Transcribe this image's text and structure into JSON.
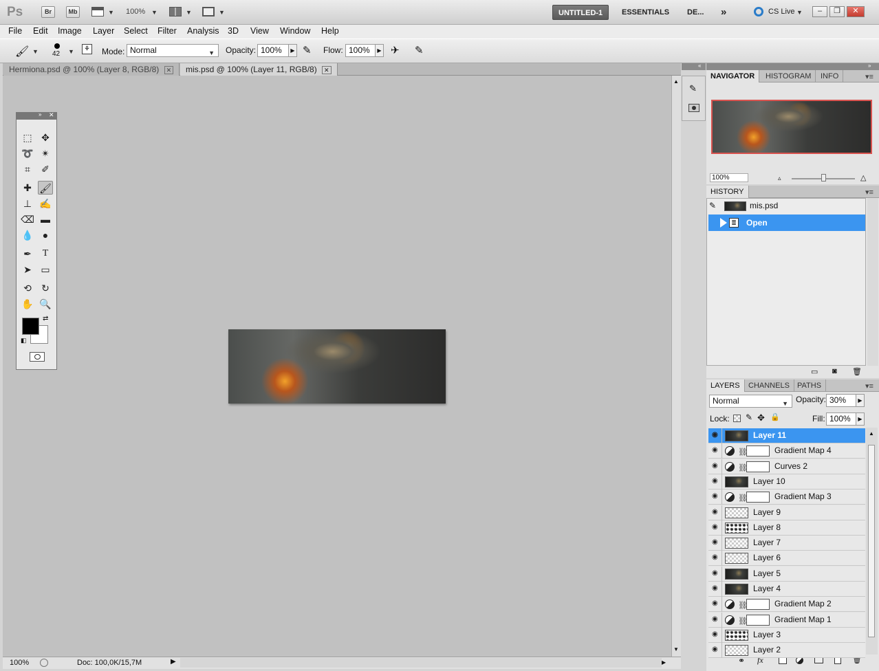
{
  "app": {
    "logo": "Ps",
    "bridge": "Br",
    "minibridge": "Mb",
    "zoom": "100%",
    "workspaces": [
      "UNTITLED-1",
      "ESSENTIALS",
      "DE..."
    ],
    "more": "»",
    "cslive": "CS Live"
  },
  "menu": [
    "File",
    "Edit",
    "Image",
    "Layer",
    "Select",
    "Filter",
    "Analysis",
    "3D",
    "View",
    "Window",
    "Help"
  ],
  "options": {
    "brush_size": "42",
    "mode_label": "Mode:",
    "mode_value": "Normal",
    "opacity_label": "Opacity:",
    "opacity_value": "100%",
    "flow_label": "Flow:",
    "flow_value": "100%"
  },
  "tabs": [
    {
      "label": "Hermiona.psd @ 100% (Layer 8, RGB/8)",
      "active": false
    },
    {
      "label": "mis.psd @ 100% (Layer 11, RGB/8)",
      "active": true
    }
  ],
  "status": {
    "zoom": "100%",
    "doc": "Doc: 100,0K/15,7M"
  },
  "navigator": {
    "tabs": [
      "NAVIGATOR",
      "HISTOGRAM",
      "INFO"
    ],
    "zoom": "100%",
    "zoom_level": 0.5
  },
  "history": {
    "title": "HISTORY",
    "snapshot": "mis.psd",
    "items": [
      "Open"
    ]
  },
  "layers": {
    "tabs": [
      "LAYERS",
      "CHANNELS",
      "PATHS"
    ],
    "blend_mode": "Normal",
    "opacity_label": "Opacity:",
    "opacity_value": "30%",
    "lock_label": "Lock:",
    "fill_label": "Fill:",
    "fill_value": "100%",
    "items": [
      {
        "name": "Layer 11",
        "kind": "photo",
        "selected": true
      },
      {
        "name": "Gradient Map 4",
        "kind": "adjustment"
      },
      {
        "name": "Curves 2",
        "kind": "adjustment"
      },
      {
        "name": "Layer 10",
        "kind": "photo"
      },
      {
        "name": "Gradient Map 3",
        "kind": "adjustment"
      },
      {
        "name": "Layer 9",
        "kind": "transparent"
      },
      {
        "name": "Layer 8",
        "kind": "mixed"
      },
      {
        "name": "Layer 7",
        "kind": "transparent"
      },
      {
        "name": "Layer 6",
        "kind": "transparent"
      },
      {
        "name": "Layer 5",
        "kind": "photo"
      },
      {
        "name": "Layer 4",
        "kind": "photo"
      },
      {
        "name": "Gradient Map 2",
        "kind": "adjustment"
      },
      {
        "name": "Gradient Map 1",
        "kind": "adjustment"
      },
      {
        "name": "Layer 3",
        "kind": "mixed"
      },
      {
        "name": "Layer 2",
        "kind": "transparent"
      }
    ]
  },
  "colors": {
    "selection": "#3b95f0",
    "navigator_frame": "#d9534f",
    "foreground": "#000000",
    "background": "#ffffff"
  }
}
